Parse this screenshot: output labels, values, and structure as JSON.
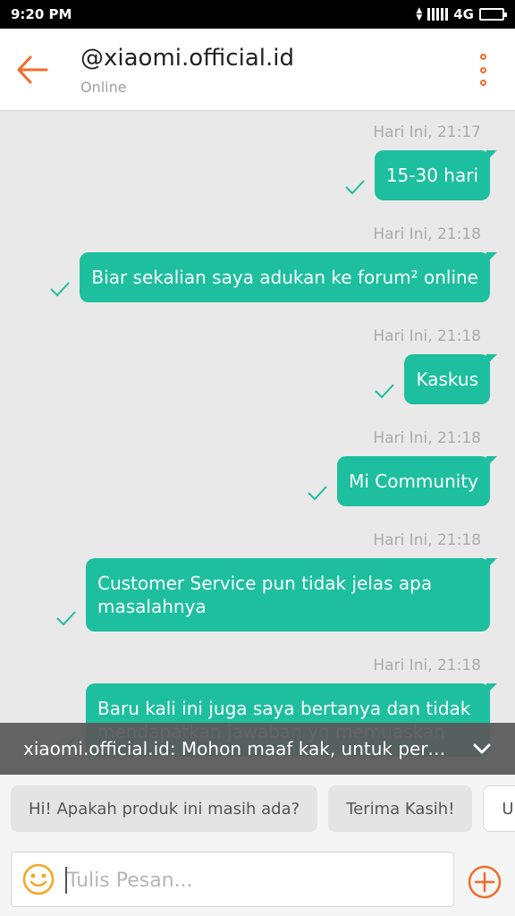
{
  "status": {
    "time": "9:20 PM",
    "network": "4G"
  },
  "header": {
    "title": "@xiaomi.official.id",
    "subtitle": "Online"
  },
  "messages": [
    {
      "time": "Hari Ini, 21:17",
      "text": "15-30 hari"
    },
    {
      "time": "Hari Ini, 21:18",
      "text": "Biar sekalian saya adukan ke forum² online"
    },
    {
      "time": "Hari Ini, 21:18",
      "text": "Kaskus"
    },
    {
      "time": "Hari Ini, 21:18",
      "text": "Mi Community"
    },
    {
      "time": "Hari Ini, 21:18",
      "text": "Customer Service pun tidak jelas apa masalahnya"
    },
    {
      "time": "Hari Ini, 21:18",
      "text": "Baru kali ini juga saya bertanya dan tidak mendapatkan jawaban yg memuaskan"
    }
  ],
  "notification": {
    "text": "xiaomi.official.id: Mohon maaf kak, untuk perm..."
  },
  "quick_replies": [
    "Hi! Apakah produk ini masih ada?",
    "Terima Kasih!",
    "Uba"
  ],
  "composer": {
    "placeholder": "Tulis Pesan..."
  },
  "colors": {
    "accent": "#f26b2a",
    "bubble": "#1dbf9e"
  }
}
